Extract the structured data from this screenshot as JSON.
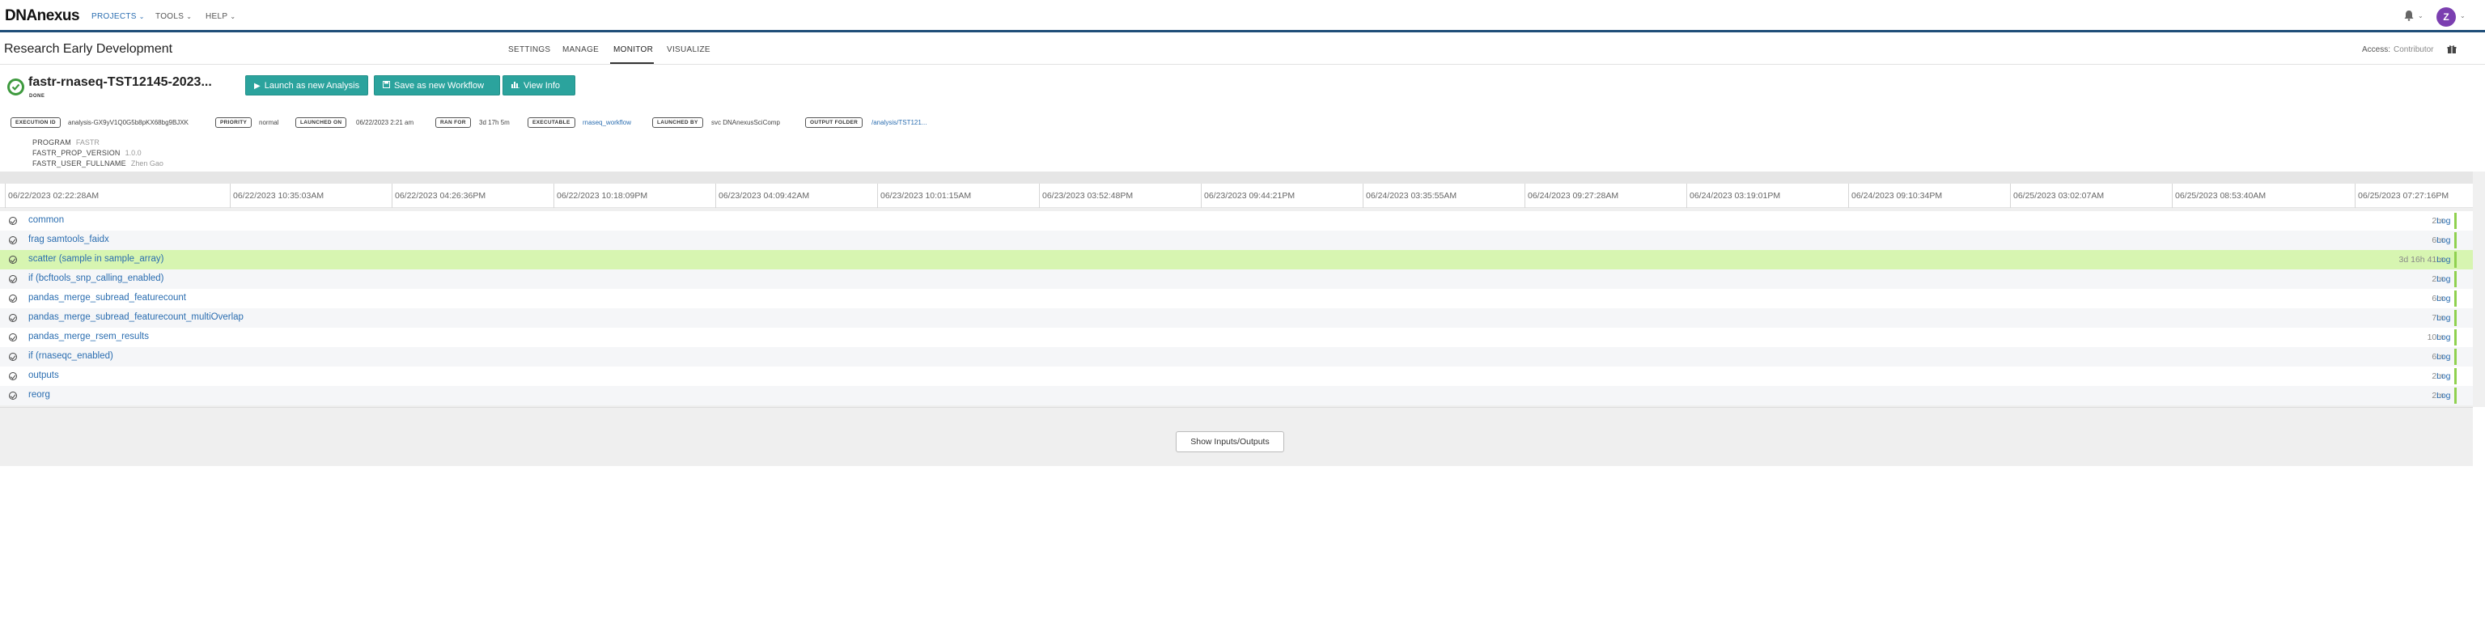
{
  "nav": {
    "logo": "DNAnexus",
    "items": [
      {
        "label": "PROJECTS",
        "active": true
      },
      {
        "label": "TOOLS",
        "active": false
      },
      {
        "label": "HELP",
        "active": false
      }
    ],
    "user_initial": "Z",
    "accent": "#1f4e79"
  },
  "project": {
    "title": "Research Early Development",
    "tabs": [
      "SETTINGS",
      "MANAGE",
      "MONITOR",
      "VISUALIZE"
    ],
    "active_tab": "MONITOR",
    "access_label": "Access:",
    "access_value": "Contributor"
  },
  "execution": {
    "name": "fastr-rnaseq-TST12145-2023...",
    "status": "DONE",
    "buttons": {
      "launch": "Launch as new Analysis",
      "save": "Save as new Workflow",
      "info": "View Info"
    },
    "button_color": "#2ba39d",
    "chips": {
      "execution_id_label": "EXECUTION ID",
      "execution_id_value": "analysis-GX9yV1Q0G5b8pKX68bg9BJXK",
      "priority_label": "PRIORITY",
      "priority_value": "normal",
      "launched_on_label": "LAUNCHED ON",
      "launched_on_value": "06/22/2023 2:21 am",
      "ran_for_label": "RAN FOR",
      "ran_for_value": "3d 17h 5m",
      "executable_label": "EXECUTABLE",
      "executable_value": "rnaseq_workflow",
      "launched_by_label": "LAUNCHED BY",
      "launched_by_value": "svc DNAnexusSciComp",
      "output_folder_label": "OUTPUT FOLDER",
      "output_folder_value": "/analysis/TST121..."
    },
    "properties": [
      {
        "key": "PROGRAM",
        "value": "FASTR"
      },
      {
        "key": "FASTR_PROP_VERSION",
        "value": "1.0.0"
      },
      {
        "key": "FASTR_USER_FULLNAME",
        "value": "Zhen Gao"
      }
    ]
  },
  "timeline": {
    "ticks": [
      "06/22/2023 02:22:28AM",
      "06/22/2023 10:35:03AM",
      "06/22/2023 04:26:36PM",
      "06/22/2023 10:18:09PM",
      "06/23/2023 04:09:42AM",
      "06/23/2023 10:01:15AM",
      "06/23/2023 03:52:48PM",
      "06/23/2023 09:44:21PM",
      "06/24/2023 03:35:55AM",
      "06/24/2023 09:27:28AM",
      "06/24/2023 03:19:01PM",
      "06/24/2023 09:10:34PM",
      "06/25/2023 03:02:07AM",
      "06/25/2023 08:53:40AM",
      "06/25/2023 07:27:16PM"
    ],
    "log_label": "Log",
    "highlight_color": "#d7f5b1",
    "stages": [
      {
        "name": "common",
        "duration": "2m"
      },
      {
        "name": "frag samtools_faidx",
        "duration": "6m"
      },
      {
        "name": "scatter (sample in sample_array)",
        "duration": "3d 16h 41m",
        "highlight": true
      },
      {
        "name": "if (bcftools_snp_calling_enabled)",
        "duration": "2m"
      },
      {
        "name": "pandas_merge_subread_featurecount",
        "duration": "6m"
      },
      {
        "name": "pandas_merge_subread_featurecount_multiOverlap",
        "duration": "7m"
      },
      {
        "name": "pandas_merge_rsem_results",
        "duration": "10m"
      },
      {
        "name": "if (rnaseqc_enabled)",
        "duration": "6m"
      },
      {
        "name": "outputs",
        "duration": "2m"
      },
      {
        "name": "reorg",
        "duration": "2m"
      }
    ],
    "io_button": "Show Inputs/Outputs"
  }
}
